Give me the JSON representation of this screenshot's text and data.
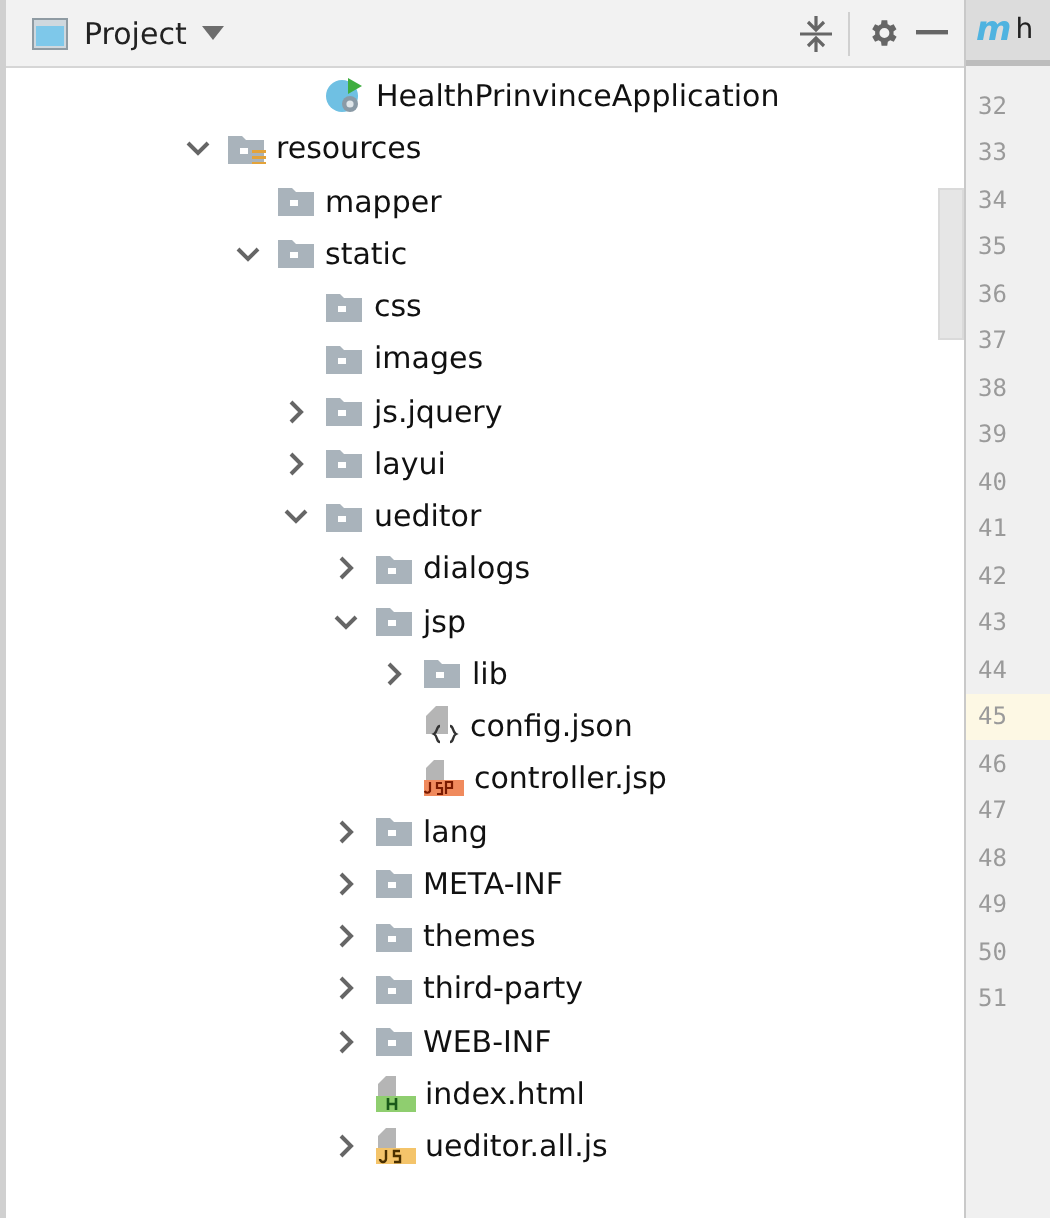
{
  "panel": {
    "title": "Project"
  },
  "editor_tab": {
    "icon_letter": "m",
    "label": "h"
  },
  "tree_above": {
    "label": "HealthPrinvinceApplication",
    "kind": "app"
  },
  "tree": [
    {
      "label": "resources",
      "kind": "resources",
      "expanded": true,
      "children": [
        {
          "label": "mapper",
          "kind": "folder"
        },
        {
          "label": "static",
          "kind": "folder",
          "expanded": true,
          "children": [
            {
              "label": "css",
              "kind": "folder"
            },
            {
              "label": "images",
              "kind": "folder"
            },
            {
              "label": "js.jquery",
              "kind": "folder",
              "expanded": false
            },
            {
              "label": "layui",
              "kind": "folder",
              "expanded": false
            },
            {
              "label": "ueditor",
              "kind": "folder",
              "expanded": true,
              "children": [
                {
                  "label": "dialogs",
                  "kind": "folder",
                  "expanded": false
                },
                {
                  "label": "jsp",
                  "kind": "folder",
                  "expanded": true,
                  "children": [
                    {
                      "label": "lib",
                      "kind": "folder",
                      "expanded": false
                    },
                    {
                      "label": "config.json",
                      "kind": "json"
                    },
                    {
                      "label": "controller.jsp",
                      "kind": "jsp"
                    }
                  ]
                },
                {
                  "label": "lang",
                  "kind": "folder",
                  "expanded": false
                },
                {
                  "label": "META-INF",
                  "kind": "folder",
                  "expanded": false
                },
                {
                  "label": "themes",
                  "kind": "folder",
                  "expanded": false
                },
                {
                  "label": "third-party",
                  "kind": "folder",
                  "expanded": false
                },
                {
                  "label": "WEB-INF",
                  "kind": "folder",
                  "expanded": false
                },
                {
                  "label": "index.html",
                  "kind": "html"
                },
                {
                  "label": "ueditor.all.js",
                  "kind": "js",
                  "expanded": false
                }
              ]
            }
          ]
        }
      ]
    }
  ],
  "line_numbers": [
    {
      "number": "32",
      "current": false
    },
    {
      "number": "33",
      "current": false
    },
    {
      "number": "34",
      "current": false
    },
    {
      "number": "35",
      "current": false
    },
    {
      "number": "36",
      "current": false
    },
    {
      "number": "37",
      "current": false
    },
    {
      "number": "38",
      "current": false
    },
    {
      "number": "39",
      "current": false
    },
    {
      "number": "40",
      "current": false
    },
    {
      "number": "41",
      "current": false
    },
    {
      "number": "42",
      "current": false
    },
    {
      "number": "43",
      "current": false
    },
    {
      "number": "44",
      "current": false
    },
    {
      "number": "45",
      "current": true
    },
    {
      "number": "46",
      "current": false
    },
    {
      "number": "47",
      "current": false
    },
    {
      "number": "48",
      "current": false
    },
    {
      "number": "49",
      "current": false
    },
    {
      "number": "50",
      "current": false
    },
    {
      "number": "51",
      "current": false
    }
  ]
}
